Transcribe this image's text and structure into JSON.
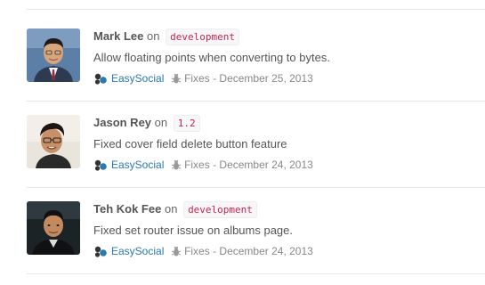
{
  "commits": [
    {
      "author": "Mark Lee",
      "on_word": "on",
      "branch": "development",
      "message": "Allow floating points when converting to bytes.",
      "repo": "EasySocial",
      "type": "Fixes",
      "separator": "-",
      "date": "December 25, 2013",
      "avatar_icon": "avatar-mark-lee"
    },
    {
      "author": "Jason Rey",
      "on_word": "on",
      "branch": "1.2",
      "message": "Fixed cover field delete button feature",
      "repo": "EasySocial",
      "type": "Fixes",
      "separator": "-",
      "date": "December 24, 2013",
      "avatar_icon": "avatar-jason-rey"
    },
    {
      "author": "Teh Kok Fee",
      "on_word": "on",
      "branch": "development",
      "message": "Fixed set router issue on albums page.",
      "repo": "EasySocial",
      "type": "Fixes",
      "separator": "-",
      "date": "December 24, 2013",
      "avatar_icon": "avatar-teh-kok-fee"
    }
  ],
  "colors": {
    "branch_text": "#c7254e",
    "repo_link": "#2a7ab0",
    "divider": "#e6e6e6"
  }
}
